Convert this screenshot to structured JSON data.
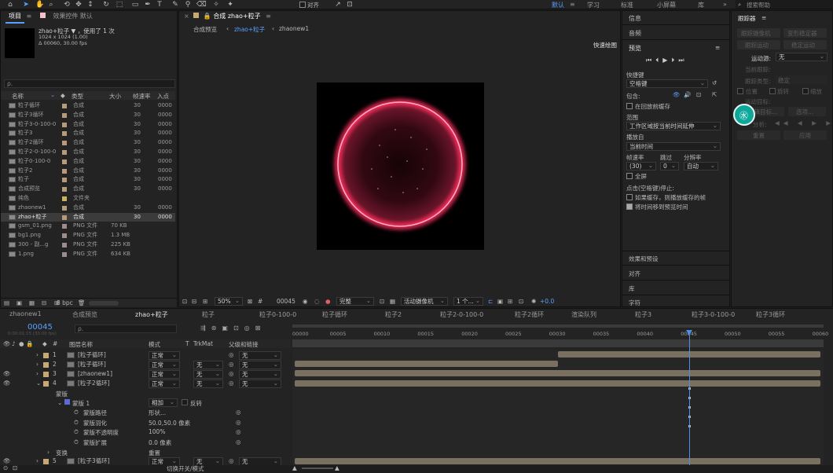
{
  "menu": {
    "workspaces": [
      "默认",
      "学习",
      "标准",
      "小屏幕",
      "库"
    ],
    "workspace_more": "»",
    "snap_label": "对齐",
    "search_placeholder": "搜索帮助"
  },
  "project": {
    "tab_label": "项目",
    "effects_tab": "效果控件 默认",
    "comp_name": "zhao+粒子 ▼ ，使用了 1 次",
    "comp_size": "1024 x 1024 (1.00)",
    "comp_duration": "Δ 00060, 30.00 fps",
    "search_placeholder": "ρ.",
    "columns": [
      "名称",
      "类型",
      "大小",
      "帧速率",
      "入点"
    ],
    "items": [
      {
        "name": "粒子循环",
        "type": "合成",
        "size": "",
        "fps": "30",
        "in": "0000",
        "swatch": "#b59b7a"
      },
      {
        "name": "粒子3循环",
        "type": "合成",
        "size": "",
        "fps": "30",
        "in": "0000",
        "swatch": "#b59b7a"
      },
      {
        "name": "粒子3-0-100-0",
        "type": "合成",
        "size": "",
        "fps": "30",
        "in": "0000",
        "swatch": "#b59b7a"
      },
      {
        "name": "粒子3",
        "type": "合成",
        "size": "",
        "fps": "30",
        "in": "0000",
        "swatch": "#b59b7a"
      },
      {
        "name": "粒子2循环",
        "type": "合成",
        "size": "",
        "fps": "30",
        "in": "0000",
        "swatch": "#b59b7a"
      },
      {
        "name": "粒子2-0-100-0",
        "type": "合成",
        "size": "",
        "fps": "30",
        "in": "0000",
        "swatch": "#b59b7a"
      },
      {
        "name": "粒子0-100-0",
        "type": "合成",
        "size": "",
        "fps": "30",
        "in": "0000",
        "swatch": "#b59b7a"
      },
      {
        "name": "粒子2",
        "type": "合成",
        "size": "",
        "fps": "30",
        "in": "0000",
        "swatch": "#b59b7a"
      },
      {
        "name": "粒子",
        "type": "合成",
        "size": "",
        "fps": "30",
        "in": "0000",
        "swatch": "#b59b7a"
      },
      {
        "name": "合成预览",
        "type": "合成",
        "size": "",
        "fps": "30",
        "in": "0000",
        "swatch": "#b59b7a"
      },
      {
        "name": "纯色",
        "type": "文件夹",
        "size": "",
        "fps": "",
        "in": "",
        "swatch": "#c8b45a"
      },
      {
        "name": "zhaonew1",
        "type": "合成",
        "size": "",
        "fps": "30",
        "in": "0000",
        "swatch": "#b59b7a"
      },
      {
        "name": "zhao+粒子",
        "type": "合成",
        "size": "",
        "fps": "30",
        "in": "0000",
        "swatch": "#b59b7a"
      },
      {
        "name": "gsm_01.png",
        "type": "PNG 文件",
        "size": "70 KB",
        "fps": "",
        "in": "",
        "swatch": "#9d8c8c"
      },
      {
        "name": "bg1.png",
        "type": "PNG 文件",
        "size": "1.3 MB",
        "fps": "",
        "in": "",
        "swatch": "#9d8c8c"
      },
      {
        "name": "300 - 副...g",
        "type": "PNG 文件",
        "size": "225 KB",
        "fps": "",
        "in": "",
        "swatch": "#9d8c8c"
      },
      {
        "name": "1.png",
        "type": "PNG 文件",
        "size": "634 KB",
        "fps": "",
        "in": "",
        "swatch": "#9d8c8c"
      }
    ],
    "bpc": "8 bpc"
  },
  "composition": {
    "title": "合成 zhao+粒子",
    "crumbs": [
      "合成预览",
      "zhao+粒子",
      "zhaonew1"
    ],
    "fast_draft": "快速绘图",
    "zoom": "50%",
    "timecode": "00045",
    "resolution": "完整",
    "camera": "活动摄像机",
    "views": "1 个...",
    "exposure": "+0.0"
  },
  "right_panel": {
    "sections": [
      "信息",
      "音频",
      "预览"
    ],
    "shortcut_label": "快捷键",
    "shortcut_value": "空格键",
    "include_label": "包含:",
    "cache_before": "在回放前缓存",
    "range_label": "范围",
    "range_value": "工作区域按当前时间延伸",
    "play_from_label": "播放自",
    "play_from_value": "当前时间",
    "fps_label": "帧速率",
    "skip_label": "跳过",
    "res_label": "分辨率",
    "fps_value": "(30)",
    "skip_value": "0",
    "res_value": "自动",
    "fullscreen": "全屏",
    "stop_label": "点击(空格键)停止:",
    "cache_opt": "如果缓存，则播放缓存的帧",
    "move_time": "将时间移到预览时间",
    "bottom_sections": [
      "效果和预设",
      "对齐",
      "库",
      "字符"
    ]
  },
  "tracker": {
    "title": "跟踪器",
    "buttons": [
      "跟踪摄像机",
      "变形稳定器",
      "跟踪运动",
      "稳定运动"
    ],
    "source_label": "运动源:",
    "source_value": "无",
    "current_track": "当前跟踪:",
    "track_type": "跟踪类型:",
    "track_type_value": "稳定",
    "position": "位置",
    "rotation": "旋转",
    "scale": "缩放",
    "motion_target": "运动目标:",
    "edit_target": "编辑目标...",
    "options": "选项...",
    "analyze": "分析:",
    "reset": "重置",
    "apply": "应用"
  },
  "timeline": {
    "tabs": [
      "zhaonew1",
      "合成预览",
      "zhao+粒子",
      "粒子",
      "粒子0-100-0",
      "粒子循环",
      "粒子2",
      "粒子2-0-100-0",
      "粒子2循环",
      "渲染队列",
      "粒子3",
      "粒子3-0-100-0",
      "粒子3循环"
    ],
    "timecode": "00045",
    "timecode_sub": "0:00:01:15 (30.00 fps)",
    "search_placeholder": "ρ.",
    "col_headers": [
      "图层名称",
      "模式",
      "T",
      "TrkMat",
      "父级和链接"
    ],
    "ruler": [
      "00000",
      "00005",
      "00010",
      "00015",
      "00020",
      "00025",
      "00030",
      "00035",
      "00040",
      "00045",
      "00050",
      "00055",
      "00060"
    ],
    "layers": [
      {
        "num": "1",
        "name": "[粒子循环]",
        "mode": "正常",
        "trk": "",
        "parent": "无"
      },
      {
        "num": "2",
        "name": "[粒子循环]",
        "mode": "正常",
        "trk": "无",
        "parent": "无"
      },
      {
        "num": "3",
        "name": "[zhaonew1]",
        "mode": "正常",
        "trk": "无",
        "parent": "无"
      },
      {
        "num": "4",
        "name": "[粒子2循环]",
        "mode": "正常",
        "trk": "无",
        "parent": "无"
      },
      {
        "num": "5",
        "name": "[粒子3循环]",
        "mode": "正常",
        "trk": "无",
        "parent": "无"
      }
    ],
    "mask_group": "蒙版",
    "mask_name": "蒙版 1",
    "mask_mode": "相加",
    "mask_invert": "反转",
    "mask_props": [
      {
        "name": "蒙版路径",
        "value": "形状..."
      },
      {
        "name": "蒙版羽化",
        "value": "50.0,50.0 像素"
      },
      {
        "name": "蒙版不透明度",
        "value": "100%"
      },
      {
        "name": "蒙版扩展",
        "value": "0.0 像素"
      }
    ],
    "transform": "变换",
    "transform_reset": "重置",
    "footer": "切换开关/模式"
  },
  "colors": {
    "accent": "#4d8fe8",
    "playhead": "#4d8fe8",
    "ring": "#ff2e5f"
  }
}
